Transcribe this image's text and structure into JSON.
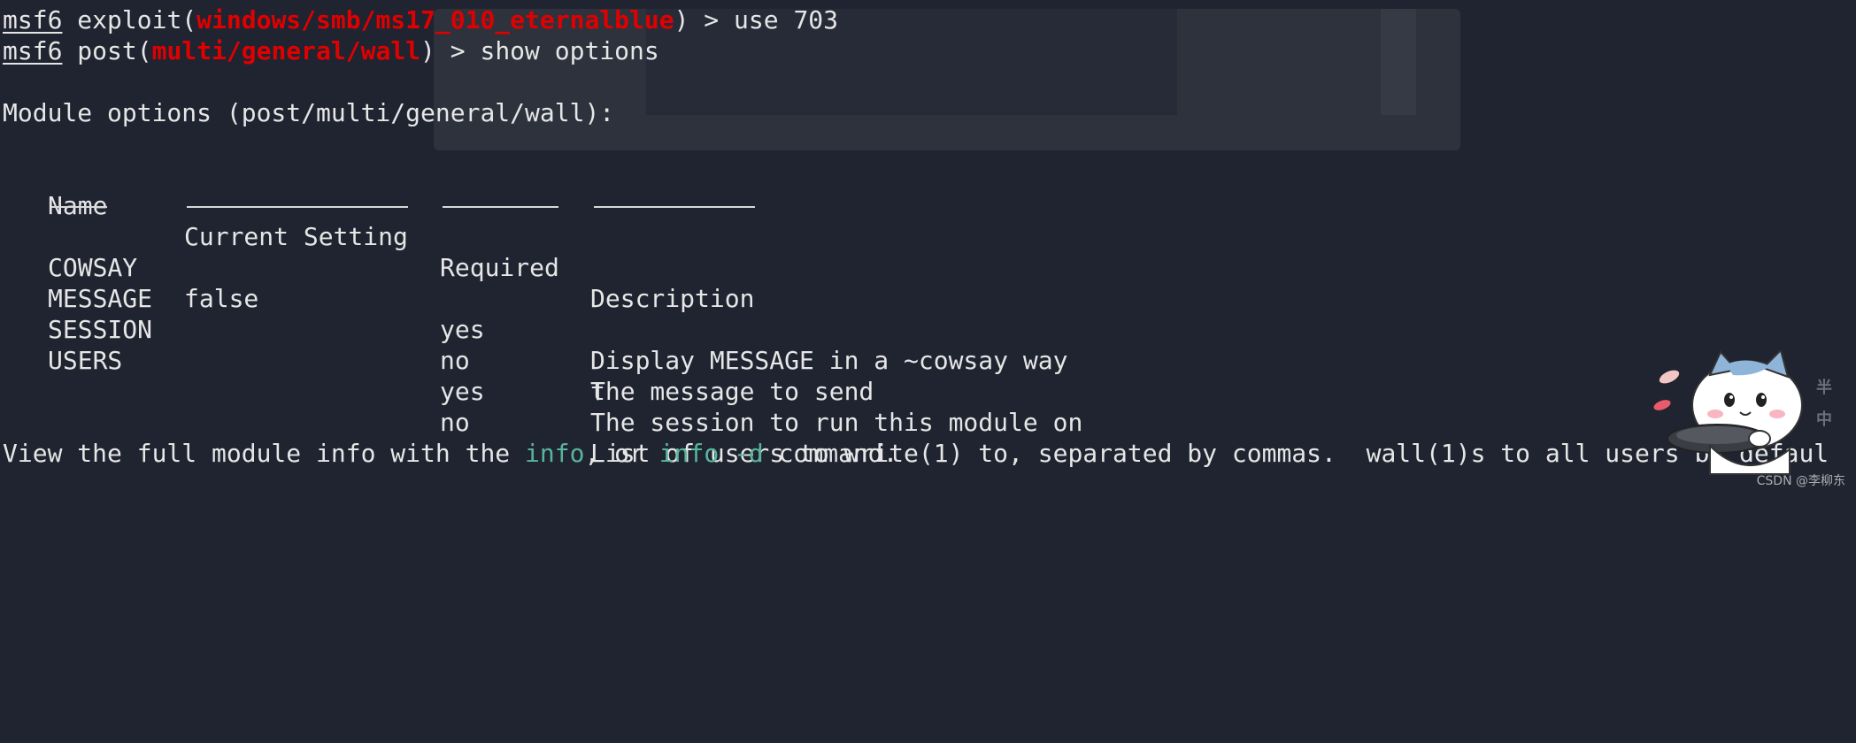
{
  "terminal": {
    "line1": {
      "prompt": "msf6",
      "mid": " exploit(",
      "module": "windows/smb/ms17_010_eternalblue",
      "tail": ") > use 703"
    },
    "line2": {
      "prompt": "msf6",
      "mid": " post(",
      "module": "multi/general/wall",
      "tail": ") > show options"
    },
    "section_title": "Module options (post/multi/general/wall):",
    "table": {
      "headers": [
        "Name",
        "Current Setting",
        "Required",
        "Description"
      ],
      "rows": [
        {
          "name": "COWSAY",
          "setting": "false",
          "required": "yes",
          "description": "Display MESSAGE in a ~cowsay way"
        },
        {
          "name": "MESSAGE",
          "setting": "",
          "required": "no",
          "description": "The message to send"
        },
        {
          "name": "SESSION",
          "setting": "",
          "required": "yes",
          "description": "The session to run this module on"
        },
        {
          "name": "USERS",
          "setting": "",
          "required": "no",
          "description": "List of users to write(1) to, separated by commas.  wall(1)s to all users by defaul",
          "description_wrap": "t"
        }
      ]
    },
    "footer": {
      "pre": "View the full module info with the ",
      "cmd1": "info",
      "mid": ", or ",
      "cmd2": "info -d",
      "post": " command."
    }
  },
  "watermark": "CSDN @李柳东",
  "side_glyphs": [
    "半",
    "中"
  ],
  "colors": {
    "background": "#1f2430",
    "text": "#e6e6e6",
    "module_red": "#e00000",
    "command_cyan": "#58b59c"
  }
}
